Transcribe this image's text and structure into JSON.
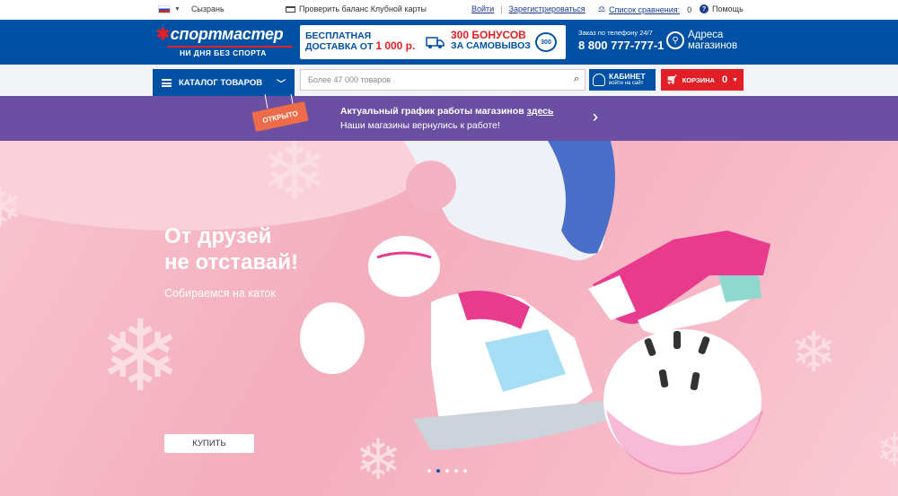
{
  "topbar": {
    "city": "Сызрань",
    "club_card": "Проверить баланс Клубной карты",
    "login": "Войти",
    "separator": "|",
    "register": "Зарегистрироваться",
    "compare": "Список сравнения:",
    "compare_count": "0",
    "help": "Помощь"
  },
  "header": {
    "brand": "спортмастер",
    "slogan": "НИ ДНЯ БЕЗ СПОРТА",
    "promo_delivery_1": "БЕСПЛАТНАЯ",
    "promo_delivery_2": "ДОСТАВКА ОТ",
    "promo_delivery_amount": "1 000 р.",
    "promo_bonus_1": "300 БОНУСОВ",
    "promo_bonus_2": "ЗА САМОВЫВОЗ",
    "promo_coin": "300",
    "phone_label": "Заказ по телефону 24/7",
    "phone": "8 800 777-777-1",
    "stores_1": "Адреса",
    "stores_2": "магазинов"
  },
  "nav": {
    "catalog": "КАТАЛОГ ТОВАРОВ",
    "search_placeholder": "Более 47 000 товаров",
    "cabinet": "КАБИНЕТ",
    "cabinet_sub": "войти на сайт",
    "cart": "КОРЗИНА",
    "cart_count": "0"
  },
  "banner": {
    "tag": "ОТКРЫТО",
    "line1": "Актуальный график работы магазинов",
    "line1_link": "здесь",
    "line2": "Наши магазины вернулись к работе!"
  },
  "hero": {
    "title_1": "От друзей",
    "title_2": "не отставай!",
    "subtitle": "Собираемся на каток",
    "button": "КУПИТЬ",
    "slides": 5,
    "active_slide": 2
  },
  "colors": {
    "brand_blue": "#0051a5",
    "brand_red": "#e21f26",
    "banner_purple": "#6a4fa3",
    "hero_pink": "#f4aebd"
  }
}
